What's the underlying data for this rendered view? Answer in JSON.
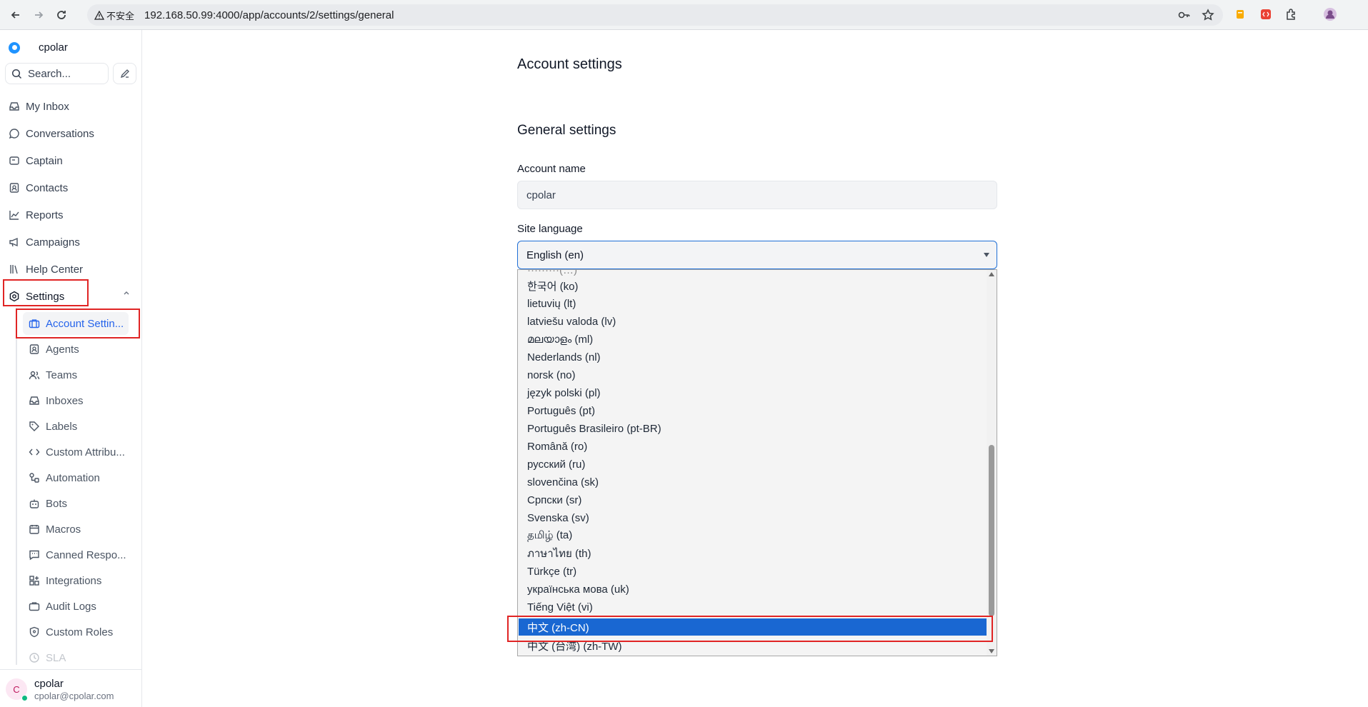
{
  "browser": {
    "security_label": "不安全",
    "url": "192.168.50.99:4000/app/accounts/2/settings/general"
  },
  "sidebar": {
    "brand": "cpolar",
    "search_placeholder": "Search...",
    "nav": [
      {
        "label": "My Inbox",
        "icon": "inbox-icon"
      },
      {
        "label": "Conversations",
        "icon": "chat-bubble-icon"
      },
      {
        "label": "Captain",
        "icon": "captain-icon"
      },
      {
        "label": "Contacts",
        "icon": "contact-card-icon"
      },
      {
        "label": "Reports",
        "icon": "chart-line-icon"
      },
      {
        "label": "Campaigns",
        "icon": "megaphone-icon"
      },
      {
        "label": "Help Center",
        "icon": "library-icon"
      },
      {
        "label": "Settings",
        "icon": "settings-icon"
      }
    ],
    "settings_items": [
      {
        "label": "Account Settin...",
        "icon": "briefcase-icon",
        "active": true
      },
      {
        "label": "Agents",
        "icon": "agent-icon"
      },
      {
        "label": "Teams",
        "icon": "team-icon"
      },
      {
        "label": "Inboxes",
        "icon": "inbox-icon"
      },
      {
        "label": "Labels",
        "icon": "tag-icon"
      },
      {
        "label": "Custom Attribu...",
        "icon": "code-icon"
      },
      {
        "label": "Automation",
        "icon": "automation-icon"
      },
      {
        "label": "Bots",
        "icon": "bot-icon"
      },
      {
        "label": "Macros",
        "icon": "macro-icon"
      },
      {
        "label": "Canned Respo...",
        "icon": "canned-response-icon"
      },
      {
        "label": "Integrations",
        "icon": "integrations-icon"
      },
      {
        "label": "Audit Logs",
        "icon": "audit-log-icon"
      },
      {
        "label": "Custom Roles",
        "icon": "shield-icon"
      },
      {
        "label": "SLA",
        "icon": "clock-icon"
      }
    ],
    "profile": {
      "initial": "C",
      "name": "cpolar",
      "email": "cpolar@cpolar.com"
    }
  },
  "main": {
    "page_title": "Account settings",
    "section_title": "General settings",
    "account_name_label": "Account name",
    "account_name_value": "cpolar",
    "site_language_label": "Site language",
    "site_language_value": "English (en)",
    "language_options": [
      "한국어 (ko)",
      "lietuvių (lt)",
      "latviešu valoda (lv)",
      "മലയാളം (ml)",
      "Nederlands (nl)",
      "norsk (no)",
      "język polski (pl)",
      "Português (pt)",
      "Português Brasileiro (pt-BR)",
      "Română (ro)",
      "русский (ru)",
      "slovenčina (sk)",
      "Српски (sr)",
      "Svenska (sv)",
      "தமிழ் (ta)",
      "ภาษาไทย (th)",
      "Türkçe (tr)",
      "українська мова (uk)",
      "Tiếng Việt (vi)",
      "中文 (zh-CN)",
      "中文 (台湾) (zh-TW)"
    ],
    "highlighted_option": "中文 (zh-CN)"
  }
}
